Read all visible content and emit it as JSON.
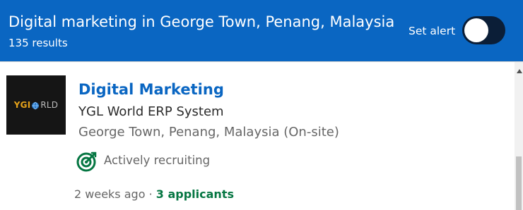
{
  "header": {
    "title": "Digital marketing in George Town, Penang, Malaysia",
    "results": "135 results",
    "set_alert_label": "Set alert",
    "alert_toggle_on": false,
    "background_color": "#0a66c2"
  },
  "job": {
    "logo_text_left": "YGI",
    "logo_text_right": "RLD",
    "title": "Digital Marketing",
    "company": "YGL World ERP System",
    "location": "George Town, Penang, Malaysia (On-site)",
    "status_icon": "target-icon",
    "status": "Actively recruiting",
    "posted": "2 weeks ago",
    "separator": "·",
    "applicants": "3 applicants",
    "title_color": "#0a66c2",
    "applicants_color": "#057642"
  }
}
